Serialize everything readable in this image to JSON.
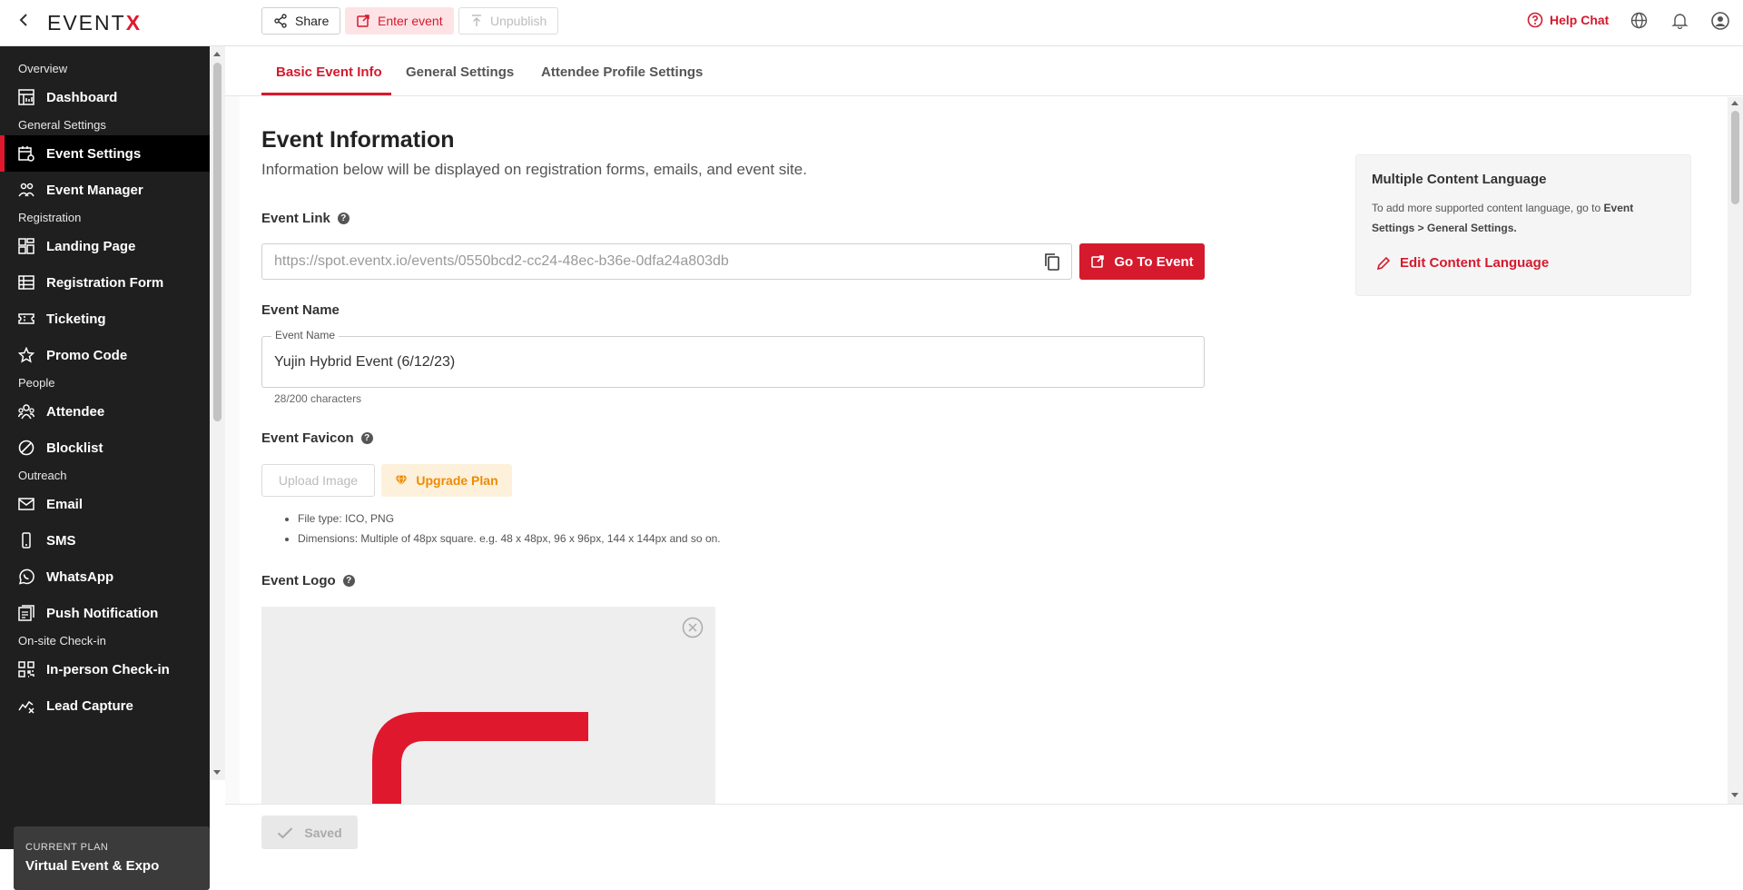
{
  "app": {
    "logo_text": "EVENT",
    "logo_accent": "X",
    "accent_color": "#d51a2e"
  },
  "topbar": {
    "share_label": "Share",
    "enter_label": "Enter event",
    "unpublish_label": "Unpublish",
    "help_label": "Help Chat"
  },
  "sidebar": {
    "sections": [
      {
        "title": "Overview",
        "items": [
          {
            "label": "Dashboard",
            "icon": "dashboard-icon"
          }
        ]
      },
      {
        "title": "General Settings",
        "items": [
          {
            "label": "Event Settings",
            "icon": "event-settings-icon",
            "active": true
          },
          {
            "label": "Event Manager",
            "icon": "people-icon"
          }
        ]
      },
      {
        "title": "Registration",
        "items": [
          {
            "label": "Landing Page",
            "icon": "layout-icon"
          },
          {
            "label": "Registration Form",
            "icon": "table-icon"
          },
          {
            "label": "Ticketing",
            "icon": "ticket-icon"
          },
          {
            "label": "Promo Code",
            "icon": "star-icon"
          }
        ]
      },
      {
        "title": "People",
        "items": [
          {
            "label": "Attendee",
            "icon": "attendee-icon"
          },
          {
            "label": "Blocklist",
            "icon": "block-icon"
          }
        ]
      },
      {
        "title": "Outreach",
        "items": [
          {
            "label": "Email",
            "icon": "mail-icon"
          },
          {
            "label": "SMS",
            "icon": "phone-icon"
          },
          {
            "label": "WhatsApp",
            "icon": "whatsapp-icon"
          },
          {
            "label": "Push Notification",
            "icon": "push-icon"
          }
        ]
      },
      {
        "title": "On-site Check-in",
        "items": [
          {
            "label": "In-person Check-in",
            "icon": "qr-icon"
          },
          {
            "label": "Lead Capture",
            "icon": "lead-icon"
          }
        ]
      }
    ],
    "plan_key": "CURRENT PLAN",
    "plan_value": "Virtual Event & Expo"
  },
  "tabs": [
    {
      "label": "Basic Event Info"
    },
    {
      "label": "General Settings"
    },
    {
      "label": "Attendee Profile Settings"
    }
  ],
  "main": {
    "title": "Event Information",
    "subtitle": "Information below will be displayed on registration forms, emails, and event site.",
    "event_link_label": "Event Link",
    "event_link_value": "https://spot.eventx.io/events/0550bcd2-cc24-48ec-b36e-0dfa24a803db",
    "go_to_event_label": "Go To Event",
    "event_name_label": "Event Name",
    "event_name_legend": "Event Name",
    "event_name_value": "Yujin Hybrid Event (6/12/23)",
    "event_name_counter": "28/200 characters",
    "favicon_label": "Event Favicon",
    "upload_label": "Upload Image",
    "upgrade_label": "Upgrade Plan",
    "favicon_notes": [
      "File type: ICO, PNG",
      "Dimensions: Multiple of 48px square. e.g. 48 x 48px, 96 x 96px, 144 x 144px and so on."
    ],
    "logo_label": "Event Logo"
  },
  "side_card": {
    "title": "Multiple Content Language",
    "desc_prefix": "To add more supported content language, go to ",
    "desc_bold": "Event Settings > General Settings.",
    "edit_label": "Edit Content Language"
  },
  "footer": {
    "saved_label": "Saved"
  }
}
